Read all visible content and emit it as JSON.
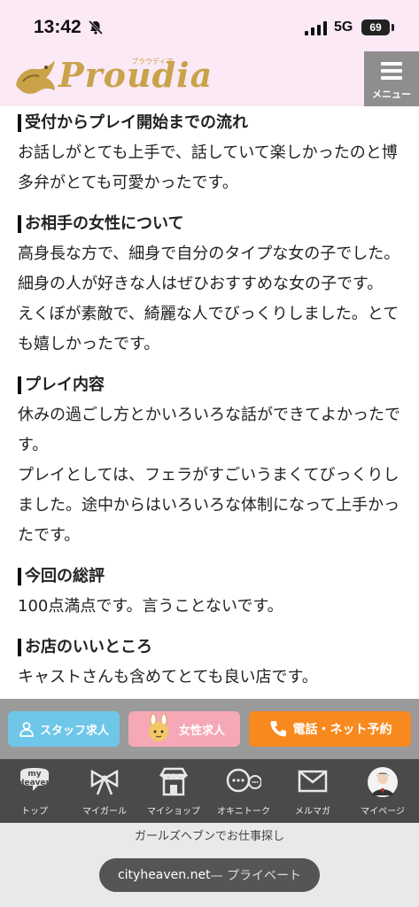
{
  "status": {
    "time": "13:42",
    "network": "5G",
    "battery": "69"
  },
  "header": {
    "logo_text": "Proudia",
    "logo_kana": "プラウディア",
    "menu_label": "メニュー"
  },
  "sections": [
    {
      "title": "受付からプレイ開始までの流れ",
      "body": "お話しがとても上手で、話していて楽しかったのと博多弁がとても可愛かったです。"
    },
    {
      "title": "お相手の女性について",
      "body": "高身長な方で、細身で自分のタイプな女の子でした。細身の人が好きな人はぜひおすすめな女の子です。\nえくぼが素敵で、綺麗な人でびっくりしました。とても嬉しかったです。"
    },
    {
      "title": "プレイ内容",
      "body": "休みの過ごし方とかいろいろな話ができてよかったです。\nプレイとしては、フェラがすごいうまくてびっくりしました。途中からはいろいろな体制になって上手かったです。"
    },
    {
      "title": "今回の総評",
      "body": "100点満点です。言うことないです。"
    },
    {
      "title": "お店のいいところ",
      "body": "キャストさんも含めてとても良い店です。"
    }
  ],
  "actions": {
    "staff": "スタッフ求人",
    "female": "女性求人",
    "call": "電話・ネット予約"
  },
  "nav": {
    "top": "トップ",
    "girl": "マイガール",
    "shop": "マイショップ",
    "talk": "オキニトーク",
    "mail": "メルマガ",
    "page": "マイページ",
    "my_heaven": "my\nHeaven"
  },
  "footer": {
    "text": "ガールズヘブンでお仕事探し",
    "url": "cityheaven.net",
    "url_suffix": " — プライベート"
  },
  "colors": {
    "header_bg": "#fbe9f6",
    "staff": "#6ec6e8",
    "female": "#f6a8b6",
    "call": "#f7891e",
    "nav_bg": "#4a4a4a"
  }
}
